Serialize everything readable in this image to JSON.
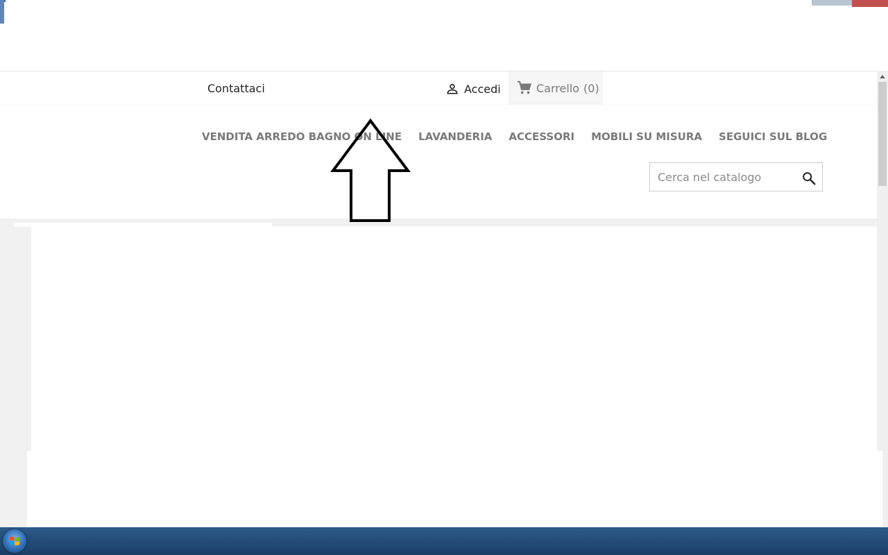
{
  "nav": {
    "contact_label": "Contattaci",
    "signin_label": "Accedi",
    "cart_label": "Carrello",
    "cart_count": "(0)"
  },
  "menu": {
    "items": [
      {
        "label": "VENDITA ARREDO BAGNO ON LINE"
      },
      {
        "label": "LAVANDERIA"
      },
      {
        "label": "ACCESSORI"
      },
      {
        "label": "MOBILI SU MISURA"
      },
      {
        "label": "SEGUICI SUL BLOG"
      }
    ]
  },
  "search": {
    "placeholder": "Cerca nel catalogo",
    "value": ""
  },
  "icons": {
    "signin": "user-icon",
    "cart": "shopping-cart-icon",
    "search": "search-icon",
    "annotation": "up-arrow-icon",
    "start": "windows-start-icon"
  },
  "colors": {
    "menu_text": "#7a7a7a",
    "body_text": "#232323",
    "cart_bg": "#f6f6f6",
    "content_bg": "#f1f1f1",
    "taskbar": "#2d5b8a"
  }
}
